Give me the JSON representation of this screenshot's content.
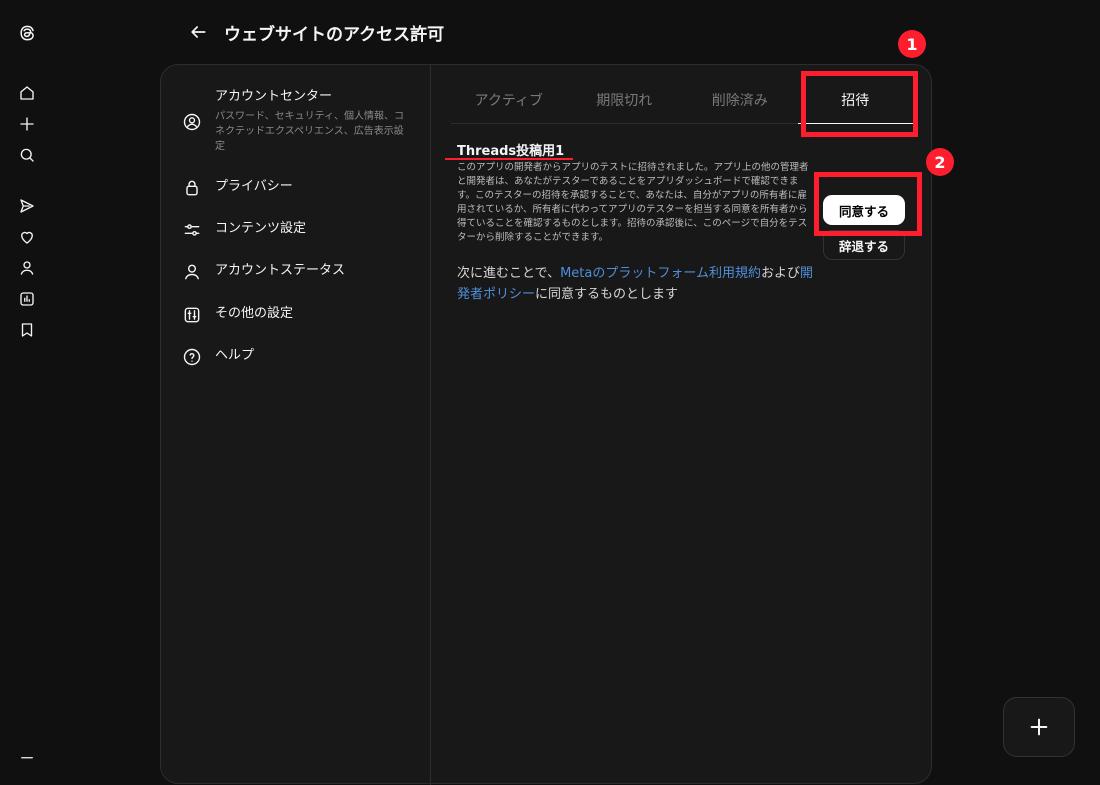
{
  "header": {
    "title": "ウェブサイトのアクセス許可"
  },
  "nav": {
    "icons": [
      "threads-logo-icon",
      "home-icon",
      "plus-icon",
      "search-icon",
      "send-icon",
      "heart-icon",
      "profile-icon",
      "insights-icon",
      "bookmark-icon",
      "menu-icon"
    ]
  },
  "settings_menu": {
    "account_center": {
      "label": "アカウントセンター",
      "sub": "パスワード、セキュリティ、個人情報、コネクテッドエクスペリエンス、広告表示設定"
    },
    "privacy": "プライバシー",
    "content": "コンテンツ設定",
    "account_status": "アカウントステータス",
    "other": "その他の設定",
    "help": "ヘルプ"
  },
  "tabs": [
    {
      "label": "アクティブ",
      "active": false
    },
    {
      "label": "期限切れ",
      "active": false
    },
    {
      "label": "削除済み",
      "active": false
    },
    {
      "label": "招待",
      "active": true
    }
  ],
  "invite": {
    "app_name": "Threads投稿用1",
    "description": "このアプリの開発者からアプリのテストに招待されました。アプリ上の他の管理者と開発者は、あなたがテスターであることをアプリダッシュボードで確認できます。このテスターの招待を承認することで、あなたは、自分がアプリの所有者に雇用されているか、所有者に代わってアプリのテスターを担当する同意を所有者から得ていることを確認するものとします。招待の承認後に、このページで自分をテスターから削除することができます。",
    "consent_prefix": "次に進むことで、",
    "consent_link1": "Metaのプラットフォーム利用規約",
    "consent_mid": "および",
    "consent_link2": "開発者ポリシー",
    "consent_suffix": "に同意するものとします",
    "accept_label": "同意する",
    "decline_label": "辞退する"
  },
  "annotations": {
    "badge1": "1",
    "badge2": "2",
    "color": "#ff1e2d"
  }
}
